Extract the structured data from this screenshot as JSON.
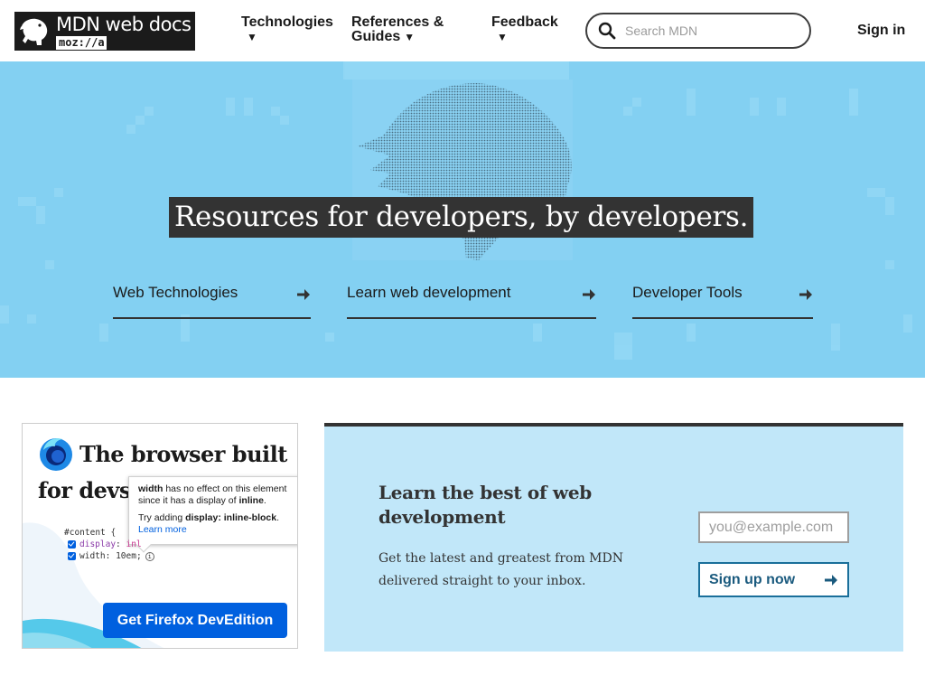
{
  "header": {
    "logo": {
      "title": "MDN web docs",
      "sub": "moz://a"
    },
    "nav": [
      {
        "label": "Technologies",
        "caret": "▼"
      },
      {
        "label": "References &",
        "label2": "Guides",
        "caret": "▼"
      },
      {
        "label": "Feedback",
        "caret": "▼"
      }
    ],
    "search": {
      "placeholder": "Search MDN",
      "value": ""
    },
    "signin": "Sign in"
  },
  "hero": {
    "title": "Resources for developers, by developers.",
    "links": [
      {
        "label": "Web Technologies"
      },
      {
        "label": "Learn web development"
      },
      {
        "label": "Developer Tools"
      }
    ]
  },
  "promo": {
    "title": "The browser built for devs",
    "tooltip": {
      "line1_prop": "width",
      "line1_rest": " has no effect on this element since it has a display of ",
      "line1_val": "inline",
      "line1_end": ".",
      "line2_pre": "Try adding ",
      "line2_code": "display: inline-block",
      "line2_end": ".",
      "learn_more": "Learn more"
    },
    "code": {
      "selector": "#content {",
      "prop1": "display",
      "val1": "inl",
      "prop2": "width",
      "val2": "10em;"
    },
    "button": "Get Firefox DevEdition"
  },
  "newsletter": {
    "title": "Learn the best of web development",
    "text": "Get the latest and greatest from MDN delivered straight to your inbox.",
    "email_placeholder": "you@example.com",
    "email_value": "",
    "button": "Sign up now"
  },
  "colors": {
    "hero_bg": "#83d0f2",
    "newsletter_bg": "#c1e7f9",
    "firefox_blue": "#0060df",
    "dark": "#1b1b1b"
  }
}
